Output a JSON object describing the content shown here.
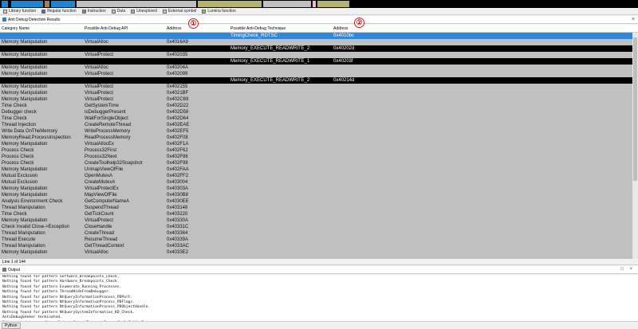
{
  "legend": [
    {
      "label": "Library function",
      "color": "#b9d9f2"
    },
    {
      "label": "Regular function",
      "color": "#1e84d4"
    },
    {
      "label": "Instruction",
      "color": "#a67c5a"
    },
    {
      "label": "Data",
      "color": "#c0c0c0"
    },
    {
      "label": "Unexplored",
      "color": "#b4b46e"
    },
    {
      "label": "External symbol",
      "color": "#f3b3e0"
    },
    {
      "label": "Lumina function",
      "color": "#6cd36a"
    }
  ],
  "results_panel": {
    "title": "Anti Debug Detection Results",
    "close": "×"
  },
  "columns": {
    "category": "Category Name",
    "api": "Possible Anti-Debug API",
    "address": "Address",
    "technique": "Possible Anti-Debug Technique",
    "tech_address": "Address"
  },
  "badges": [
    "①",
    "②"
  ],
  "rows": [
    {
      "style": "sel",
      "c1": "",
      "c2": "",
      "c3": "",
      "c4": "TimingCheck_RDTSC",
      "c5": "0x4010bc"
    },
    {
      "style": "normal",
      "c1": "Memory Manipulation",
      "c2": "VirtualAlloc",
      "c3": "0x4016A9",
      "c4": "",
      "c5": ""
    },
    {
      "style": "black",
      "c1": "",
      "c2": "",
      "c3": "",
      "c4": "Memory_EXECUTE_READWRITE_2",
      "c5": "0x40202d"
    },
    {
      "style": "normal",
      "c1": "Memory Manipulation",
      "c2": "VirtualProtect",
      "c3": "0x402035",
      "c4": "",
      "c5": ""
    },
    {
      "style": "black",
      "c1": "",
      "c2": "",
      "c3": "",
      "c4": "Memory_EXECUTE_READWRITE_1",
      "c5": "0x40203f"
    },
    {
      "style": "normal",
      "c1": "Memory Manipulation",
      "c2": "VirtualAlloc",
      "c3": "0x40204A",
      "c4": "",
      "c5": ""
    },
    {
      "style": "normal",
      "c1": "Memory Manipulation",
      "c2": "VirtualProtect",
      "c3": "0x402099",
      "c4": "",
      "c5": ""
    },
    {
      "style": "black",
      "c1": "",
      "c2": "",
      "c3": "",
      "c4": "Memory_EXECUTE_READWRITE_2",
      "c5": "0x40214d"
    },
    {
      "style": "normal",
      "c1": "Memory Manipulation",
      "c2": "VirtualProtect",
      "c3": "0x402155",
      "c4": "",
      "c5": ""
    },
    {
      "style": "normal",
      "c1": "Memory Manipulation",
      "c2": "VirtualProtect",
      "c3": "0x4021BF",
      "c4": "",
      "c5": ""
    },
    {
      "style": "normal",
      "c1": "Memory Manipulation",
      "c2": "VirtualProtect",
      "c3": "0x402C69",
      "c4": "",
      "c5": ""
    },
    {
      "style": "normal",
      "c1": "Time Check",
      "c2": "GetSystemTime",
      "c3": "0x402D22",
      "c4": "",
      "c5": ""
    },
    {
      "style": "normal",
      "c1": "Debugger check",
      "c2": "IsDebuggerPresent",
      "c3": "0x402D58",
      "c4": "",
      "c5": ""
    },
    {
      "style": "normal",
      "c1": "Time Check",
      "c2": "WaitForSingleObject",
      "c3": "0x402D64",
      "c4": "",
      "c5": ""
    },
    {
      "style": "normal",
      "c1": "Thread Injection",
      "c2": "CreateRemoteThread",
      "c3": "0x402EAE",
      "c4": "",
      "c5": ""
    },
    {
      "style": "normal",
      "c1": "Write Data OnTheMemory",
      "c2": "WriteProcessMemory",
      "c3": "0x402EF5",
      "c4": "",
      "c5": ""
    },
    {
      "style": "normal",
      "c1": "MemoryRead,ProcessInspection",
      "c2": "ReadProcessMemory",
      "c3": "0x402F08",
      "c4": "",
      "c5": ""
    },
    {
      "style": "normal",
      "c1": "Memory Manipulation",
      "c2": "VirtualAllocEx",
      "c3": "0x402F1A",
      "c4": "",
      "c5": ""
    },
    {
      "style": "normal",
      "c1": "Process Check",
      "c2": "Process32First",
      "c3": "0x402F62",
      "c4": "",
      "c5": ""
    },
    {
      "style": "normal",
      "c1": "Process Check",
      "c2": "Process32Next",
      "c3": "0x402F86",
      "c4": "",
      "c5": ""
    },
    {
      "style": "normal",
      "c1": "Process Check",
      "c2": "CreateToolhelp32Snapshot",
      "c3": "0x402F98",
      "c4": "",
      "c5": ""
    },
    {
      "style": "normal",
      "c1": "Memory Manipulation",
      "c2": "UnmapViewOfFile",
      "c3": "0x402FAA",
      "c4": "",
      "c5": ""
    },
    {
      "style": "normal",
      "c1": "Mutual Exclusion",
      "c2": "OpenMutexA",
      "c3": "0x402FF2",
      "c4": "",
      "c5": ""
    },
    {
      "style": "normal",
      "c1": "Mutual Exclusion",
      "c2": "CreateMutexA",
      "c3": "0x403004",
      "c4": "",
      "c5": ""
    },
    {
      "style": "normal",
      "c1": "Memory Manipulation",
      "c2": "VirtualProtectEx",
      "c3": "0x40303A",
      "c4": "",
      "c5": ""
    },
    {
      "style": "normal",
      "c1": "Memory Manipulation",
      "c2": "MapViewOfFile",
      "c3": "0x4030B8",
      "c4": "",
      "c5": ""
    },
    {
      "style": "normal",
      "c1": "Analysis Environment Check",
      "c2": "GetComputerNameA",
      "c3": "0x4030EE",
      "c4": "",
      "c5": ""
    },
    {
      "style": "normal",
      "c1": "Thread Manipulation",
      "c2": "SuspendThread",
      "c3": "0x403148",
      "c4": "",
      "c5": ""
    },
    {
      "style": "normal",
      "c1": "Time Check",
      "c2": "GetTickCount",
      "c3": "0x403220",
      "c4": "",
      "c5": ""
    },
    {
      "style": "normal",
      "c1": "Memory Manipulation",
      "c2": "VirtualProtect",
      "c3": "0x40330A",
      "c4": "",
      "c5": ""
    },
    {
      "style": "normal",
      "c1": "Check Invalid Close->Exception",
      "c2": "CloseHandle",
      "c3": "0x40331C",
      "c4": "",
      "c5": ""
    },
    {
      "style": "normal",
      "c1": "Thread Manipulation",
      "c2": "CreateThread",
      "c3": "0x403364",
      "c4": "",
      "c5": ""
    },
    {
      "style": "normal",
      "c1": "Thread Execute",
      "c2": "ResumeThread",
      "c3": "0x40339A",
      "c4": "",
      "c5": ""
    },
    {
      "style": "normal",
      "c1": "Thread Manipulation",
      "c2": "GetThreadContext",
      "c3": "0x4033AC",
      "c4": "",
      "c5": ""
    },
    {
      "style": "normal",
      "c1": "Memory Manipulation",
      "c2": "VirtualAlloc",
      "c3": "0x4033E2",
      "c4": "",
      "c5": ""
    }
  ],
  "status": "Line 1 of 144",
  "output_panel": {
    "title": "Output",
    "controls": "□ ×"
  },
  "output_lines": [
    "Nothing found for pattern Software_Breakpoints_Check.",
    "Nothing found for pattern Hardware_Breakpoints_Check.",
    "Nothing found for pattern Enumerate_Running_Processes.",
    "Nothing found for pattern ThreadHideFromDebugger.",
    "Nothing found for pattern NtQueryInformationProcess_PDPort.",
    "Nothing found for pattern NtQueryInformationProcess_PDFlags.",
    "Nothing found for pattern NtQueryInformationProcess_PDObjectHandle.",
    "Nothing found for pattern NtQuerySystemInformation_KD_Check.",
    "AntiDebugSeeker terminated.",
    "Edit anti_debug.config : Switch Other Tab and Press Ctrl+Shift+E."
  ],
  "python_button": "Python",
  "colors": {
    "selected_row": "#2f88d8",
    "highlight_row": "#000000",
    "table_bg": "#c0c0c0",
    "badge": "#d01818"
  }
}
